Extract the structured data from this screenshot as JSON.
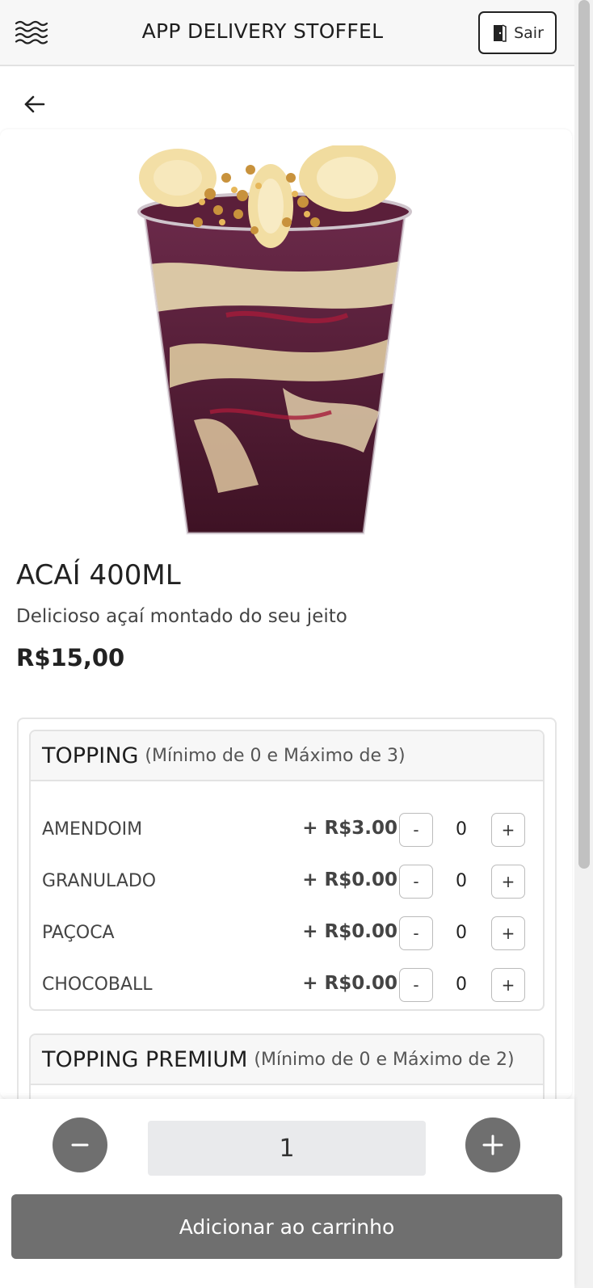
{
  "header": {
    "title": "APP DELIVERY STOFFEL",
    "logout_label": "Sair",
    "menu_icon": "wave-menu-icon",
    "logout_icon": "door-icon"
  },
  "navigation": {
    "back_icon": "arrow-left-icon"
  },
  "product": {
    "image": "acai-cup-image",
    "name": "ACAÍ 400ML",
    "description": "Delicioso açaí montado do seu jeito",
    "price": "R$15,00"
  },
  "groups": [
    {
      "name": "TOPPING",
      "range": "(Mínimo de 0 e Máximo de 3)",
      "items": [
        {
          "name": "AMENDOIM",
          "price": "+ R$3.00",
          "qty": "0"
        },
        {
          "name": "GRANULADO",
          "price": "+ R$0.00",
          "qty": "0"
        },
        {
          "name": "PAÇOCA",
          "price": "+ R$0.00",
          "qty": "0"
        },
        {
          "name": "CHOCOBALL",
          "price": "+ R$0.00",
          "qty": "0"
        }
      ],
      "minus_label": "-",
      "plus_label": "+"
    },
    {
      "name": "TOPPING PREMIUM",
      "range": "(Mínimo de 0 e Máximo de 2)"
    }
  ],
  "footer": {
    "quantity": "1",
    "add_to_cart_label": "Adicionar ao carrinho",
    "accent_color": "#6f6f6f"
  }
}
